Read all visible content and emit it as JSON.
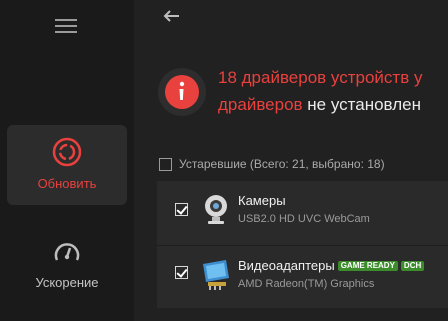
{
  "sidebar": {
    "items": [
      {
        "label": "Обновить",
        "icon": "refresh-icon",
        "active": true
      },
      {
        "label": "Ускорение",
        "icon": "speedometer-icon",
        "active": false
      }
    ]
  },
  "alert": {
    "line1_red": "18 драйверов устройств у",
    "line2_red": "драйверов",
    "line2_white": " не установлен"
  },
  "filter": {
    "label": "Устаревшие (Всего: 21, выбрано: 18)",
    "checked": false
  },
  "devices": [
    {
      "title": "Камеры",
      "subtitle": "USB2.0 HD UVC WebCam",
      "icon": "webcam-icon",
      "checked": true,
      "badges": []
    },
    {
      "title": "Видеоадаптеры",
      "subtitle": "AMD Radeon(TM) Graphics",
      "icon": "video-card-icon",
      "checked": true,
      "badges": [
        "GAME READY",
        "DCH"
      ]
    }
  ],
  "colors": {
    "accent_red": "#e8413e",
    "badge_green": "#3c8c2b",
    "background": "#212121",
    "sidebar": "#1a1a1a"
  }
}
